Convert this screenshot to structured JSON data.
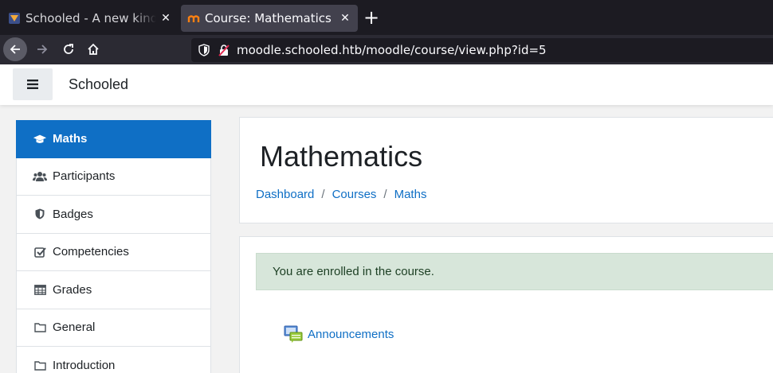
{
  "browser": {
    "tabs": [
      {
        "title": "Schooled - A new kind of",
        "active": false
      },
      {
        "title": "Course: Mathematics",
        "active": true
      }
    ],
    "new_tab": "+",
    "url": "moodle.schooled.htb/moodle/course/view.php?id=5"
  },
  "header": {
    "site_name": "Schooled"
  },
  "sidebar": {
    "items": [
      {
        "label": "Maths",
        "icon": "graduation-cap-icon",
        "active": true
      },
      {
        "label": "Participants",
        "icon": "users-icon",
        "active": false
      },
      {
        "label": "Badges",
        "icon": "shield-icon",
        "active": false
      },
      {
        "label": "Competencies",
        "icon": "check-square-icon",
        "active": false
      },
      {
        "label": "Grades",
        "icon": "table-icon",
        "active": false
      },
      {
        "label": "General",
        "icon": "folder-icon",
        "active": false
      },
      {
        "label": "Introduction",
        "icon": "folder-icon",
        "active": false
      }
    ]
  },
  "main": {
    "title": "Mathematics",
    "breadcrumb": [
      "Dashboard",
      "Courses",
      "Maths"
    ],
    "breadcrumb_sep": "/",
    "alert": "You are enrolled in the course.",
    "activity": {
      "label": "Announcements",
      "icon": "forum-icon"
    }
  },
  "colors": {
    "accent": "#0f6fc5",
    "alert_bg": "#d7e6da"
  }
}
